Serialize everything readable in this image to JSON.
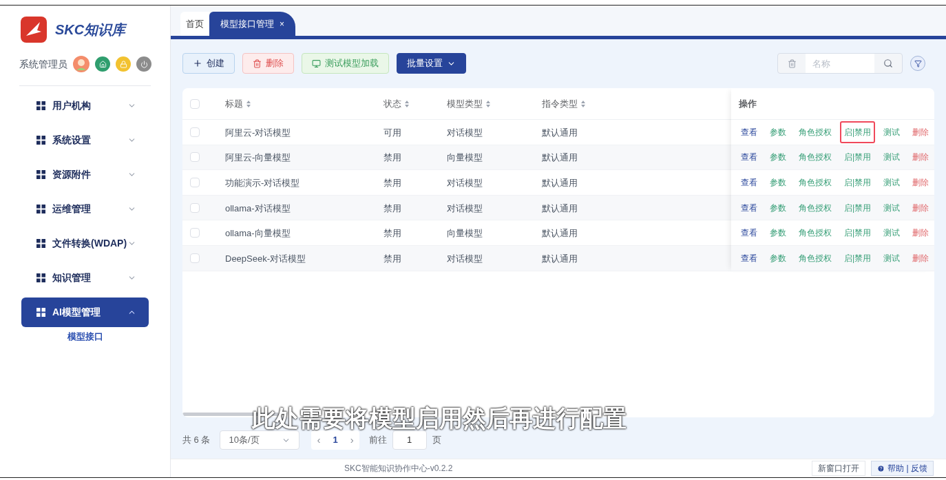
{
  "brand": {
    "name": "SKC知识库"
  },
  "user": {
    "name": "系统管理员"
  },
  "sidebar": {
    "items": [
      {
        "label": "用户机构",
        "expanded": false,
        "selected": false
      },
      {
        "label": "系统设置",
        "expanded": false,
        "selected": false
      },
      {
        "label": "资源附件",
        "expanded": false,
        "selected": false
      },
      {
        "label": "运维管理",
        "expanded": false,
        "selected": false
      },
      {
        "label": "文件转换(WDAP)",
        "expanded": false,
        "selected": false
      },
      {
        "label": "知识管理",
        "expanded": false,
        "selected": false
      },
      {
        "label": "AI模型管理",
        "expanded": true,
        "selected": true,
        "children": [
          {
            "label": "模型接口",
            "selected": true
          }
        ]
      }
    ]
  },
  "tabs": [
    {
      "label": "首页",
      "selected": false,
      "closable": false
    },
    {
      "label": "模型接口管理",
      "selected": true,
      "closable": true,
      "close": "×"
    }
  ],
  "toolbar": {
    "buttons": [
      {
        "label": "创建",
        "kind": "create"
      },
      {
        "label": "删除",
        "kind": "delete"
      },
      {
        "label": "测试模型加载",
        "kind": "test"
      },
      {
        "label": "批量设置",
        "kind": "menu"
      }
    ],
    "search": {
      "placeholder": "名称"
    }
  },
  "table": {
    "header_checked": false,
    "columns": [
      {
        "label": "标题",
        "sortable": true
      },
      {
        "label": "状态",
        "sortable": true
      },
      {
        "label": "模型类型",
        "sortable": true
      },
      {
        "label": "指令类型",
        "sortable": true
      },
      {
        "label": "操作",
        "sortable": false
      }
    ],
    "rows": [
      {
        "checked": false,
        "cells": [
          "阿里云-对话模型",
          "可用",
          "对话模型",
          "默认通用"
        ],
        "actions": [
          {
            "label": "查看",
            "kind": "view",
            "highlighted": false
          },
          {
            "label": "参数",
            "kind": "edit",
            "highlighted": false
          },
          {
            "label": "角色授权",
            "kind": "edit",
            "highlighted": false
          },
          {
            "label": "启|禁用",
            "kind": "edit",
            "highlighted": true
          },
          {
            "label": "测试",
            "kind": "edit",
            "highlighted": false
          },
          {
            "label": "删除",
            "kind": "danger",
            "highlighted": false
          }
        ]
      },
      {
        "checked": false,
        "cells": [
          "阿里云-向量模型",
          "禁用",
          "向量模型",
          "默认通用"
        ],
        "actions": [
          {
            "label": "查看",
            "kind": "view",
            "highlighted": false
          },
          {
            "label": "参数",
            "kind": "edit",
            "highlighted": false
          },
          {
            "label": "角色授权",
            "kind": "edit",
            "highlighted": false
          },
          {
            "label": "启|禁用",
            "kind": "edit",
            "highlighted": false
          },
          {
            "label": "测试",
            "kind": "edit",
            "highlighted": false
          },
          {
            "label": "删除",
            "kind": "danger",
            "highlighted": false
          }
        ]
      },
      {
        "checked": false,
        "cells": [
          "功能演示-对话模型",
          "禁用",
          "对话模型",
          "默认通用"
        ],
        "actions": [
          {
            "label": "查看",
            "kind": "view",
            "highlighted": false
          },
          {
            "label": "参数",
            "kind": "edit",
            "highlighted": false
          },
          {
            "label": "角色授权",
            "kind": "edit",
            "highlighted": false
          },
          {
            "label": "启|禁用",
            "kind": "edit",
            "highlighted": false
          },
          {
            "label": "测试",
            "kind": "edit",
            "highlighted": false
          },
          {
            "label": "删除",
            "kind": "danger",
            "highlighted": false
          }
        ]
      },
      {
        "checked": false,
        "cells": [
          "ollama-对话模型",
          "禁用",
          "对话模型",
          "默认通用"
        ],
        "actions": [
          {
            "label": "查看",
            "kind": "view",
            "highlighted": false
          },
          {
            "label": "参数",
            "kind": "edit",
            "highlighted": false
          },
          {
            "label": "角色授权",
            "kind": "edit",
            "highlighted": false
          },
          {
            "label": "启|禁用",
            "kind": "edit",
            "highlighted": false
          },
          {
            "label": "测试",
            "kind": "edit",
            "highlighted": false
          },
          {
            "label": "删除",
            "kind": "danger",
            "highlighted": false
          }
        ]
      },
      {
        "checked": false,
        "cells": [
          "ollama-向量模型",
          "禁用",
          "向量模型",
          "默认通用"
        ],
        "actions": [
          {
            "label": "查看",
            "kind": "view",
            "highlighted": false
          },
          {
            "label": "参数",
            "kind": "edit",
            "highlighted": false
          },
          {
            "label": "角色授权",
            "kind": "edit",
            "highlighted": false
          },
          {
            "label": "启|禁用",
            "kind": "edit",
            "highlighted": false
          },
          {
            "label": "测试",
            "kind": "edit",
            "highlighted": false
          },
          {
            "label": "删除",
            "kind": "danger",
            "highlighted": false
          }
        ]
      },
      {
        "checked": false,
        "cells": [
          "DeepSeek-对话模型",
          "禁用",
          "对话模型",
          "默认通用"
        ],
        "actions": [
          {
            "label": "查看",
            "kind": "view",
            "highlighted": false
          },
          {
            "label": "参数",
            "kind": "edit",
            "highlighted": false
          },
          {
            "label": "角色授权",
            "kind": "edit",
            "highlighted": false
          },
          {
            "label": "启|禁用",
            "kind": "edit",
            "highlighted": false
          },
          {
            "label": "测试",
            "kind": "edit",
            "highlighted": false
          },
          {
            "label": "删除",
            "kind": "danger",
            "highlighted": false
          }
        ]
      }
    ]
  },
  "pagination": {
    "total": "共 6 条",
    "page_size": "10条/页",
    "prev": "‹",
    "page": "1",
    "next": "›",
    "goto_label": "前往",
    "goto_value": "1",
    "page_unit": "页"
  },
  "footer": {
    "version": "SKC智能知识协作中心-v0.2.2",
    "buttons": [
      "新窗口打开",
      "帮助 | 反馈"
    ]
  },
  "subtitle": "此处需要将模型启用然后再进行配置"
}
